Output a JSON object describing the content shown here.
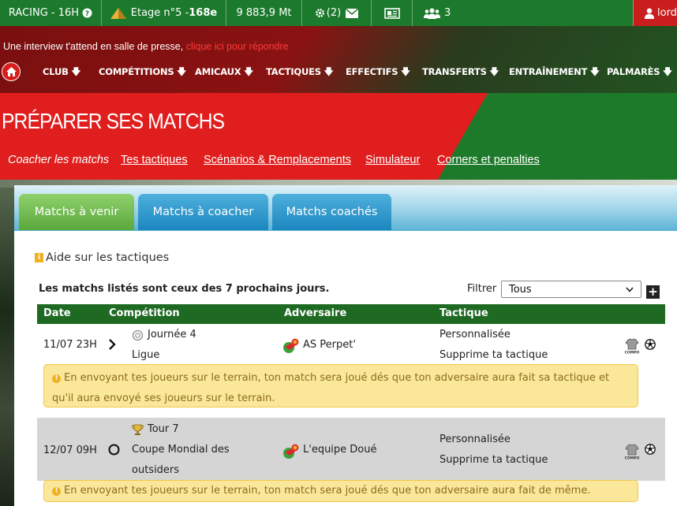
{
  "topbar": {
    "club": "RACING - 16H",
    "help_icon": "question-circle-icon",
    "floor_label": "Etage n°5 - ",
    "floor_value": "168e",
    "money": "9 883,9 Mt",
    "settings_count": "(2)",
    "friends_count": "3",
    "user": "lord"
  },
  "message": {
    "text": "Une interview t'attend en salle de presse, ",
    "link": "clique ici pour répondre"
  },
  "nav": {
    "items": [
      "CLUB",
      "COMPÉTITIONS",
      "AMICAUX",
      "TACTIQUES",
      "EFFECTIFS",
      "TRANSFERTS",
      "ENTRAÎNEMENT",
      "PALMARÈS"
    ],
    "arrow": "🡇"
  },
  "page_title": "PRÉPARER SES MATCHS",
  "subnav": [
    "Coacher les matchs",
    "Tes tactiques",
    "Scénarios & Remplacements",
    "Simulateur",
    "Corners et penalties"
  ],
  "tabs": [
    "Matchs à venir",
    "Matchs à coacher",
    "Matchs coachés"
  ],
  "help_link": "Aide sur les tactiques",
  "info_note": "Les matchs listés sont ceux des 7 prochains jours.",
  "filter": {
    "label": "Filtrer",
    "value": "Tous"
  },
  "table": {
    "headers": [
      "Date",
      "Compétition",
      "Adversaire",
      "Tactique"
    ],
    "rows": [
      {
        "date": "11/07 23H",
        "comp_line1": "Journée 4",
        "comp_line2": "Ligue",
        "opponent": "AS Perpet'",
        "tactic": "Personnalisée",
        "tactic_action": "Supprime ta tactique",
        "warning": "En envoyant tes joueurs sur le terrain, ton match sera joué dés que ton adversaire aura fait sa tactique et qu'il aura envoyé ses joueurs sur le terrain."
      },
      {
        "date": "12/07 09H",
        "comp_line1": "Tour 7",
        "comp_line2_bold": "Coupe",
        "comp_line2": " Mondial des",
        "comp_line3": "outsiders",
        "opponent": "L'equipe Doué",
        "tactic": "Personnalisée",
        "tactic_action": "Supprime ta tactique",
        "warning": "En envoyant tes joueurs sur le terrain, ton match sera joué dés que ton adversaire aura fait de même."
      }
    ]
  }
}
